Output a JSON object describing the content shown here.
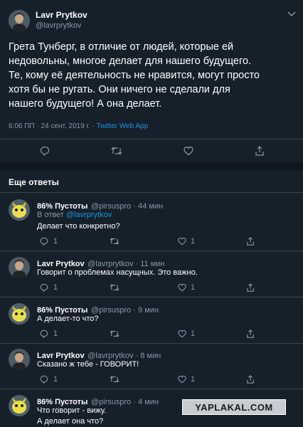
{
  "main_tweet": {
    "author_name": "Lavr Prytkov",
    "author_handle": "@lavrprytkov",
    "text_lines": [
      "Грета Тунберг, в отличие от людей, которые ей",
      "недовольны, многое делает для нашего будущего.",
      "Те, кому её деятельность не нравится, могут просто",
      "хотя бы не ругать. Они ничего не сделали для",
      "нашего будущего! А она делает."
    ],
    "meta_time": "6:06 ПП · 24 сент. 2019 г. · ",
    "meta_source": "Twitter Web App"
  },
  "section_title": "Еще ответы",
  "replies": [
    {
      "name": "86% Пустоты",
      "handle": "@pirsuspro",
      "time": " · 44 мин",
      "reply_to_label": "В ответ ",
      "reply_to_handle": "@lavrprytkov",
      "lines": [
        "Делает что конкретно?"
      ],
      "reply_count": "1",
      "like_count": "1"
    },
    {
      "name": "Lavr Prytkov",
      "handle": "@lavrprytkov",
      "time": " · 11 мин",
      "lines": [
        "Говорит о проблемах насущных. Это важно."
      ],
      "reply_count": "1",
      "like_count": "1"
    },
    {
      "name": "86% Пустоты",
      "handle": "@pirsuspro",
      "time": " · 9 мин",
      "lines": [
        "А делает-то что?"
      ],
      "reply_count": "1",
      "like_count": "1"
    },
    {
      "name": "Lavr Prytkov",
      "handle": "@lavrprytkov",
      "time": " · 8 мин",
      "lines": [
        "Сказано ж тебе - ГОВОРИТ!"
      ],
      "reply_count": "1",
      "like_count": "1"
    },
    {
      "name": "86% Пустоты",
      "handle": "@pirsuspro",
      "time": " · 4 мин",
      "lines": [
        "Что говорит - вижу.",
        "А делает она что?"
      ]
    }
  ],
  "watermark": "YAPLAKAL.COM",
  "colors": {
    "background": "#15202b",
    "divider": "#38444d",
    "muted": "#8899a6",
    "link": "#1b95e0"
  },
  "icons": [
    "reply-icon",
    "retweet-icon",
    "like-icon",
    "share-icon",
    "chevron-down-icon"
  ]
}
